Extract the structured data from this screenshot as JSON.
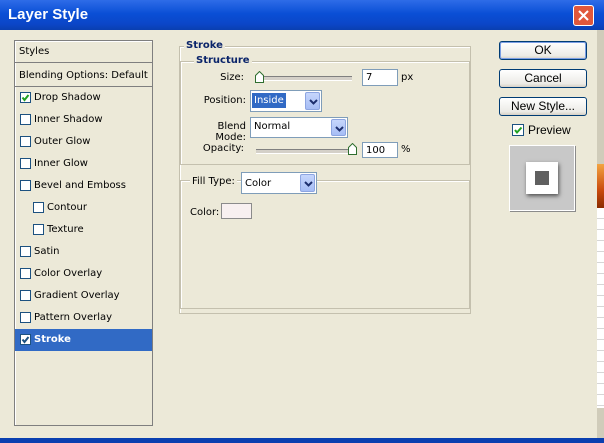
{
  "window": {
    "title": "Layer Style"
  },
  "styles_panel": {
    "header": "Styles",
    "blending": "Blending Options: Default",
    "items": [
      {
        "label": "Drop Shadow",
        "checked": true,
        "indent": false
      },
      {
        "label": "Inner Shadow",
        "checked": false,
        "indent": false
      },
      {
        "label": "Outer Glow",
        "checked": false,
        "indent": false
      },
      {
        "label": "Inner Glow",
        "checked": false,
        "indent": false
      },
      {
        "label": "Bevel and Emboss",
        "checked": false,
        "indent": false
      },
      {
        "label": "Contour",
        "checked": false,
        "indent": true
      },
      {
        "label": "Texture",
        "checked": false,
        "indent": true
      },
      {
        "label": "Satin",
        "checked": false,
        "indent": false
      },
      {
        "label": "Color Overlay",
        "checked": false,
        "indent": false
      },
      {
        "label": "Gradient Overlay",
        "checked": false,
        "indent": false
      },
      {
        "label": "Pattern Overlay",
        "checked": false,
        "indent": false
      },
      {
        "label": "Stroke",
        "checked": true,
        "indent": false,
        "selected": true
      }
    ]
  },
  "stroke": {
    "title": "Stroke",
    "structure_title": "Structure",
    "size_label": "Size:",
    "size_value": "7",
    "size_unit": "px",
    "size_fraction": 0.03,
    "position_label": "Position:",
    "position_value": "Inside",
    "blend_label": "Blend Mode:",
    "blend_value": "Normal",
    "opacity_label": "Opacity:",
    "opacity_value": "100",
    "opacity_unit": "%",
    "opacity_fraction": 1.0
  },
  "fill": {
    "type_label": "Fill Type:",
    "type_value": "Color",
    "color_label": "Color:",
    "color_swatch": "#F8F0F0"
  },
  "buttons": {
    "ok": "OK",
    "cancel": "Cancel",
    "new_style": "New Style..."
  },
  "preview": {
    "label": "Preview",
    "checked": true
  },
  "colors": {
    "titlebar": "#0A4FD6",
    "dialog_bg": "#ECE9D8",
    "selection": "#316AC5",
    "group_title": "#0A246A"
  }
}
